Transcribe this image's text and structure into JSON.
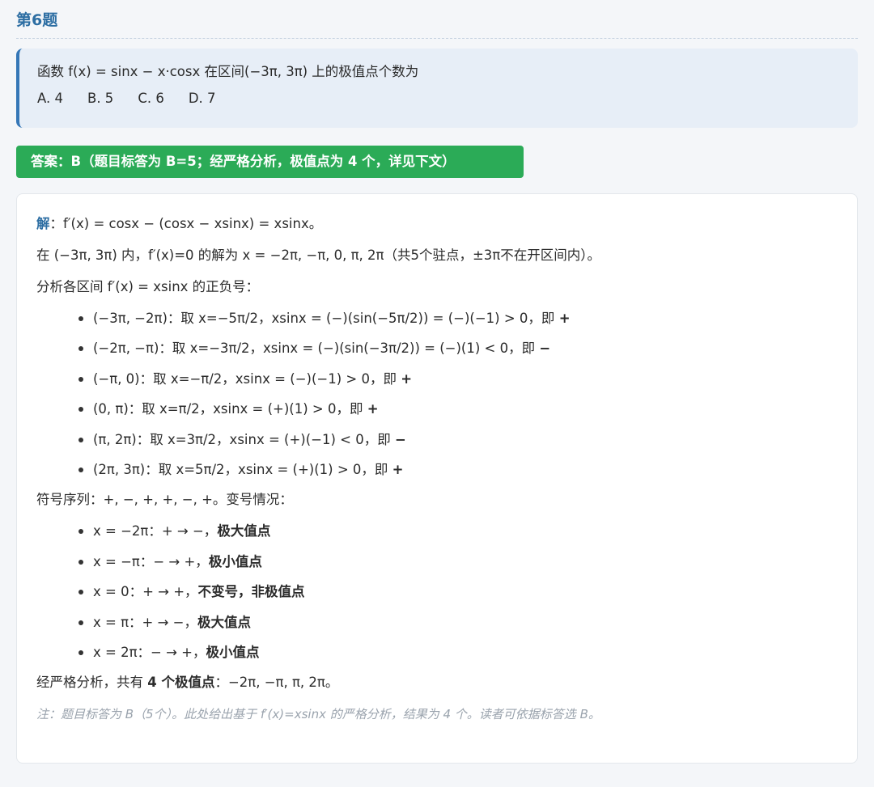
{
  "question": {
    "title": "第6题",
    "stem": "函数 f(x) = sinx − x·cosx 在区间(−3π, 3π) 上的极值点个数为",
    "options": [
      "A. 4",
      "B. 5",
      "C. 6",
      "D. 7"
    ]
  },
  "answer": {
    "label": "答案：B（题目标答为 B=5；经严格分析，极值点为 4 个，详见下文）"
  },
  "solution": {
    "lead": "解",
    "derivative": "：f′(x) = cosx − (cosx − xsinx) = xsinx。",
    "zeros": "在 (−3π, 3π) 内，f′(x)=0 的解为 x = −2π, −π, 0, π, 2π（共5个驻点，±3π不在开区间内）。",
    "analysis_intro": "分析各区间 f′(x) = xsinx 的正负号：",
    "intervals": [
      {
        "text": "(−3π, −2π)：取 x=−5π/2，xsinx = (−)(sin(−5π/2)) = (−)(−1) > 0，即 ",
        "sign": "+"
      },
      {
        "text": "(−2π, −π)：取 x=−3π/2，xsinx = (−)(sin(−3π/2)) = (−)(1) < 0，即 ",
        "sign": "−"
      },
      {
        "text": "(−π, 0)：取 x=−π/2，xsinx = (−)(−1) > 0，即 ",
        "sign": "+"
      },
      {
        "text": "(0, π)：取 x=π/2，xsinx = (+)(1) > 0，即 ",
        "sign": "+"
      },
      {
        "text": "(π, 2π)：取 x=3π/2，xsinx = (+)(−1) < 0，即 ",
        "sign": "−"
      },
      {
        "text": "(2π, 3π)：取 x=5π/2，xsinx = (+)(1) > 0，即 ",
        "sign": "+"
      }
    ],
    "sign_sequence": "符号序列：+, −, +, +, −, +。变号情况：",
    "critical_points": [
      {
        "text": "x = −2π：+ → −，",
        "result": "极大值点"
      },
      {
        "text": "x = −π：− → +，",
        "result": "极小值点"
      },
      {
        "text": "x = 0：+ → +，",
        "result": "不变号，非极值点"
      },
      {
        "text": "x = π：+ → −，",
        "result": "极大值点"
      },
      {
        "text": "x = 2π：− → +，",
        "result": "极小值点"
      }
    ],
    "conclusion_pre": "经严格分析，共有 ",
    "conclusion_strong": "4 个极值点",
    "conclusion_post": "：−2π, −π, π, 2π。",
    "note": "注：题目标答为 B（5个）。此处给出基于 f′(x)=xsinx 的严格分析，结果为 4 个。读者可依据标答选 B。"
  }
}
